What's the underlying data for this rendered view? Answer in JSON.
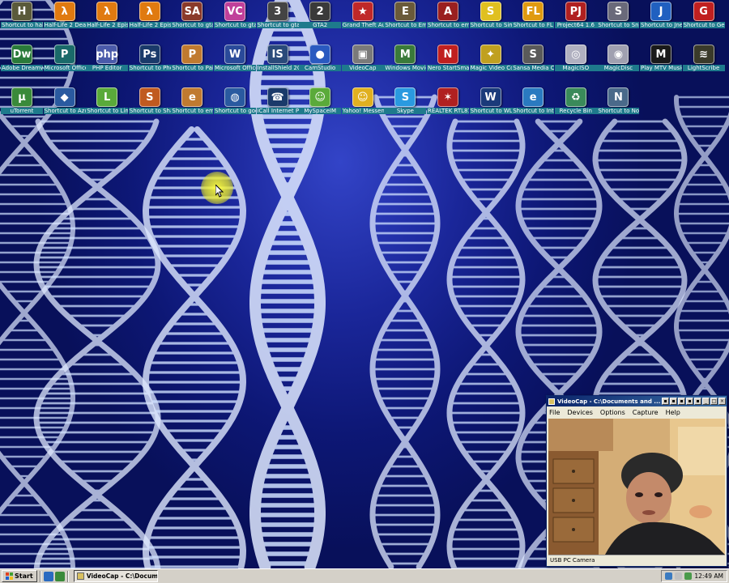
{
  "desktop": {
    "icons": [
      {
        "label": "Shortcut to halo",
        "icon": "halo-icon",
        "color": "#5a5a3a",
        "glyph": "H"
      },
      {
        "label": "Half-Life 2 Deathmatch",
        "icon": "half-life-icon",
        "color": "#e07a10",
        "glyph": "λ"
      },
      {
        "label": "Half-Life 2 Episode One",
        "icon": "half-life-icon",
        "color": "#e07a10",
        "glyph": "λ"
      },
      {
        "label": "Half-Life 2 Episode Two",
        "icon": "half-life-icon",
        "color": "#e07a10",
        "glyph": "λ"
      },
      {
        "label": "Shortcut to gta_sa",
        "icon": "gta-sa-icon",
        "color": "#8a3a2a",
        "glyph": "SA"
      },
      {
        "label": "Shortcut to gta-vc",
        "icon": "gta-vc-icon",
        "color": "#c0409a",
        "glyph": "VC"
      },
      {
        "label": "Shortcut to gta3",
        "icon": "gta3-icon",
        "color": "#444444",
        "glyph": "3"
      },
      {
        "label": "GTA2",
        "icon": "gta2-icon",
        "color": "#3a3a3a",
        "glyph": "2"
      },
      {
        "label": "Grand Theft Auto",
        "icon": "gta-flag-icon",
        "color": "#c02828",
        "glyph": "★"
      },
      {
        "label": "Shortcut to Empire Earth",
        "icon": "empire-earth-icon",
        "color": "#6a5a3a",
        "glyph": "E"
      },
      {
        "label": "Shortcut to empires2",
        "icon": "empires2-icon",
        "color": "#9a2020",
        "glyph": "A"
      },
      {
        "label": "Shortcut to Simpsons",
        "icon": "simpsons-icon",
        "color": "#e0c020",
        "glyph": "S"
      },
      {
        "label": "Shortcut to FL",
        "icon": "fl-studio-icon",
        "color": "#e09a10",
        "glyph": "FL"
      },
      {
        "label": "Project64 1.6",
        "icon": "project64-icon",
        "color": "#b02020",
        "glyph": "PJ"
      },
      {
        "label": "Shortcut to Snes9X",
        "icon": "snes9x-icon",
        "color": "#6a6a7a",
        "glyph": "S"
      },
      {
        "label": "Shortcut to Jnes",
        "icon": "jnes-icon",
        "color": "#2060c0",
        "glyph": "J"
      },
      {
        "label": "Shortcut to Gens32",
        "icon": "gens32-icon",
        "color": "#c02020",
        "glyph": "G"
      },
      {
        "label": "Adobe Dreamwea...",
        "icon": "dreamweaver-icon",
        "color": "#2a7a3a",
        "glyph": "Dw"
      },
      {
        "label": "Microsoft Office Publ...",
        "icon": "publisher-icon",
        "color": "#1a6a6a",
        "glyph": "P"
      },
      {
        "label": "PHP Editor",
        "icon": "php-editor-icon",
        "color": "#4a5aaa",
        "glyph": "php"
      },
      {
        "label": "Shortcut to Photoshop",
        "icon": "photoshop-icon",
        "color": "#1a3a6a",
        "glyph": "Ps"
      },
      {
        "label": "Shortcut to Paint Shop...",
        "icon": "paint-shop-icon",
        "color": "#c07a30",
        "glyph": "P"
      },
      {
        "label": "Microsoft Office W...",
        "icon": "word-icon",
        "color": "#2a4a9a",
        "glyph": "W"
      },
      {
        "label": "InstallShield 2009",
        "icon": "installshield-icon",
        "color": "#2a4a7a",
        "glyph": "IS"
      },
      {
        "label": "CamStudio",
        "icon": "camstudio-icon",
        "color": "#2a5ac0",
        "glyph": "●"
      },
      {
        "label": "VideoCap",
        "icon": "videocap-icon",
        "color": "#7a7a7a",
        "glyph": "▣"
      },
      {
        "label": "Windows Movie Maker",
        "icon": "movie-maker-icon",
        "color": "#3a7a3a",
        "glyph": "M"
      },
      {
        "label": "Nero StartSmart",
        "icon": "nero-icon",
        "color": "#c02020",
        "glyph": "N"
      },
      {
        "label": "Magic Video Converter",
        "icon": "magic-video-icon",
        "color": "#c0a020",
        "glyph": "✦"
      },
      {
        "label": "Sansa Media Converter",
        "icon": "sansa-icon",
        "color": "#5a5a5a",
        "glyph": "S"
      },
      {
        "label": "MagicISO",
        "icon": "magiciso-icon",
        "color": "#b0b0c0",
        "glyph": "◎"
      },
      {
        "label": "MagicDisc",
        "icon": "magicdisc-icon",
        "color": "#a0a0b0",
        "glyph": "◉"
      },
      {
        "label": "Play MTV Music G...",
        "icon": "mtv-music-icon",
        "color": "#1a1a1a",
        "glyph": "M"
      },
      {
        "label": "LightScribe",
        "icon": "lightscribe-icon",
        "color": "#3a3a2a",
        "glyph": "≋"
      },
      {
        "label": "uTorrent",
        "icon": "utorrent-icon",
        "color": "#3a8a3a",
        "glyph": "µ"
      },
      {
        "label": "Shortcut to Azureus",
        "icon": "azureus-icon",
        "color": "#2a5aa0",
        "glyph": "◆"
      },
      {
        "label": "Shortcut to LimeWire",
        "icon": "limewire-icon",
        "color": "#5aaa3a",
        "glyph": "L"
      },
      {
        "label": "Shortcut to Shareaza",
        "icon": "shareaza-icon",
        "color": "#c05a20",
        "glyph": "S"
      },
      {
        "label": "Shortcut to emule",
        "icon": "emule-icon",
        "color": "#c07a30",
        "glyph": "e"
      },
      {
        "label": "Shortcut to googleearth",
        "icon": "google-earth-icon",
        "color": "#2a5aa0",
        "glyph": "◍"
      },
      {
        "label": "iCall Internet Phone",
        "icon": "icall-icon",
        "color": "#1a3a6a",
        "glyph": "☎"
      },
      {
        "label": "MySpaceIM",
        "icon": "myspaceim-icon",
        "color": "#5aaa3a",
        "glyph": "☺"
      },
      {
        "label": "Yahoo! Messenger",
        "icon": "yahoo-messenger-icon",
        "color": "#e0b020",
        "glyph": "☺"
      },
      {
        "label": "Skype",
        "icon": "skype-icon",
        "color": "#2a9ae0",
        "glyph": "S"
      },
      {
        "label": "REALTEK RTL8185 ...",
        "icon": "realtek-icon",
        "color": "#b02020",
        "glyph": "✶"
      },
      {
        "label": "Shortcut to WLANUTL",
        "icon": "wlanutl-icon",
        "color": "#1a3a7a",
        "glyph": "W"
      },
      {
        "label": "Shortcut to Internet",
        "icon": "internet-explorer-icon",
        "color": "#2a7ac0",
        "glyph": "e"
      },
      {
        "label": "Recycle Bin",
        "icon": "recycle-bin-icon",
        "color": "#3a8a5a",
        "glyph": "♻"
      },
      {
        "label": "Shortcut to NoCharge",
        "icon": "nocharge-icon",
        "color": "#4a6a8a",
        "glyph": "N"
      }
    ]
  },
  "videocap": {
    "title": "VideoCap - C:\\Documents and ...",
    "menu": [
      "File",
      "Devices",
      "Options",
      "Capture",
      "Help"
    ],
    "status": "USB PC Camera"
  },
  "taskbar": {
    "start_label": "Start",
    "task_label": "VideoCap - C:\\Docum...",
    "clock": "12:49 AM"
  },
  "colors": {
    "wallpaper_blue": "#1a2699",
    "icon_label_bg": "#1e7a8c",
    "titlebar": "#0a246a",
    "taskbar": "#d4d0c8",
    "cursor_highlight": "#e6e628"
  }
}
